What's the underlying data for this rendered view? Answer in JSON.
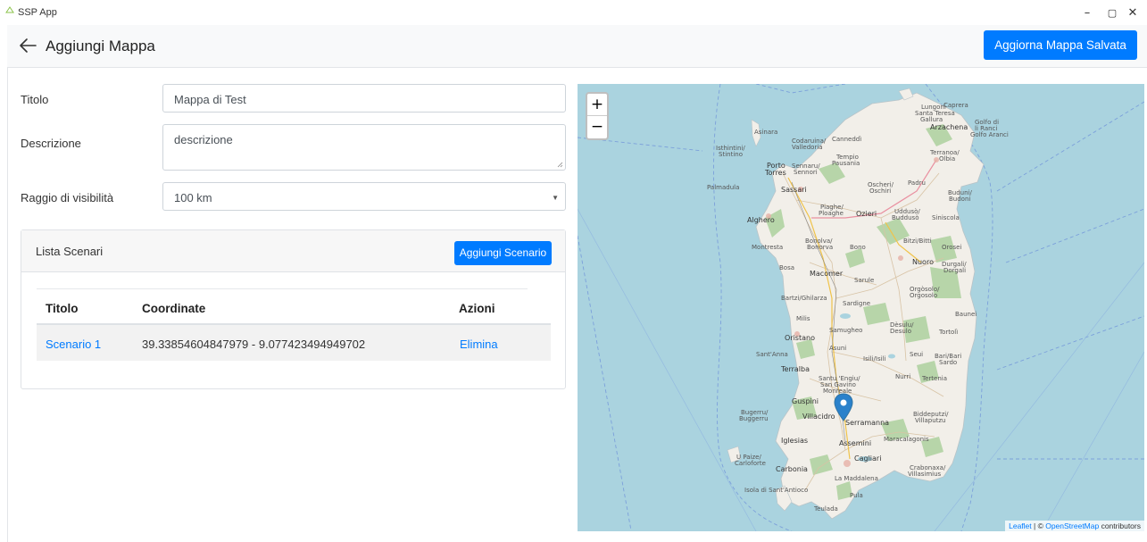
{
  "window": {
    "title": "SSP App",
    "minimize": "–",
    "maximize": "▢",
    "close": "✕"
  },
  "header": {
    "title": "Aggiungi Mappa",
    "save_button": "Aggiorna Mappa Salvata"
  },
  "form": {
    "title_label": "Titolo",
    "title_value": "Mappa di Test",
    "description_label": "Descrizione",
    "description_value": "descrizione",
    "radius_label": "Raggio di visibilità",
    "radius_value": "100 km"
  },
  "scenarios": {
    "card_title": "Lista Scenari",
    "add_button": "Aggiungi Scenario",
    "columns": [
      "Titolo",
      "Coordinate",
      "Azioni"
    ],
    "rows": [
      {
        "title": "Scenario 1",
        "coordinates": "39.33854604847979 - 9.077423494949702",
        "action": "Elimina"
      }
    ]
  },
  "map": {
    "zoom_in": "+",
    "zoom_out": "−",
    "attribution_leaflet": "Leaflet",
    "attribution_sep": " | © ",
    "attribution_osm": "OpenStreetMap",
    "attribution_suffix": " contributors",
    "marker_color": "#2a81cb",
    "labels": {
      "lungoni": "Lungoni",
      "santa_teresa": "Santa Teresa",
      "gallura": "Gallura",
      "caprera": "Caprera",
      "golfo_di": "Golfo di",
      "li_ranci": "li Ranci",
      "golfo_aranci": "Golfo Aranci",
      "arzachena": "Arzachena",
      "asinara": "Asinara",
      "codaruina": "Codaruina/",
      "valledoria": "Valledoria",
      "cannedd": "Canneddì",
      "isthintini": "Isthintini/",
      "stintino": "Stintino",
      "tempio": "Tempio",
      "pausania": "Pausania",
      "terranoa": "Terranoa/",
      "olbia": "Olbia",
      "porto": "Porto",
      "torres": "Torres",
      "sennaru": "Sennaru/",
      "sennori": "Sennori",
      "palmadula": "Palmadula",
      "sassari": "Sassari",
      "oscheri": "Oscheri/",
      "oschiri": "Oschiri",
      "padru": "Padru",
      "buduni": "Buduni/",
      "budoni": "Budoni",
      "plaghe": "Piaghe/",
      "ploaghe": "Ploaghe",
      "ozieri": "Ozieri",
      "uddus": "Uddusò/",
      "budduso": "Buddusò",
      "siniscola": "Siniscola",
      "alghero": "Alghero",
      "bitzi": "Bitzi/Bitti",
      "montresta": "Montresta",
      "bonolva": "Bonolva/",
      "bonorva": "Bonorva",
      "bono": "Bono",
      "orosei": "Orosei",
      "nuoro": "Nuoro",
      "durgali": "Durgali/",
      "dorgali": "Dorgali",
      "bosa": "Bosa",
      "macomer": "Macomer",
      "sarule": "Sarule",
      "orgosolo": "Orgòsolo/",
      "orgosolo2": "Orgosolo",
      "bartzi": "Bartzi/Ghilarza",
      "sardigne": "Sardigne",
      "baunei": "Baunei",
      "milis": "Milis",
      "samugheo": "Samugheo",
      "desulu": "Dèsulu/",
      "desulo": "Desulo",
      "tortoli": "Tortolì",
      "oristano": "Oristano",
      "asuni": "Asuni",
      "santanna": "Sant'Anna",
      "seui": "Seui",
      "bari": "Bari/Bari",
      "sardo": "Sardo",
      "isili": "Isili/Isili",
      "terralba": "Terralba",
      "santu": "Santu 'Engiu/",
      "sangavino": "San Gavino",
      "monreale": "Monreale",
      "nurri": "Nurri",
      "tertenia": "Tertenia",
      "guspini": "Guspini",
      "bugerru": "Bugerru/",
      "buggerru": "Buggerru",
      "villacidro": "Villacidro",
      "serramanna": "Serramanna",
      "biddeputzi": "Biddeputzi/",
      "villaputzu": "Villaputzu",
      "iglesias": "Iglesias",
      "assemini": "Assemini",
      "maracalagonis": "Maracalagonis",
      "upaize": "U Paize/",
      "carloforte": "Carloforte",
      "cagliari": "Cagliari",
      "carbonia": "Carbonia",
      "crabonaxa": "Crabonaxa/",
      "villasimius": "Villasimius",
      "lamaddalena": "La Maddalena",
      "isola": "Isola di Sant'Antioco",
      "pula": "Pula",
      "teulada": "Teulada"
    }
  }
}
